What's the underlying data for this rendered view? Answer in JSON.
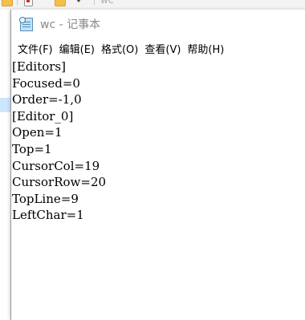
{
  "background_window": {
    "title": "wc"
  },
  "window": {
    "title": "wc - 记事本",
    "icon": "notepad-icon"
  },
  "menubar": {
    "items": [
      {
        "label": "文件(F)"
      },
      {
        "label": "编辑(E)"
      },
      {
        "label": "格式(O)"
      },
      {
        "label": "查看(V)"
      },
      {
        "label": "帮助(H)"
      }
    ]
  },
  "editor": {
    "lines": [
      "[Editors]",
      "Focused=0",
      "Order=-1,0",
      "[Editor_0]",
      "Open=1",
      "Top=1",
      "CursorCol=19",
      "CursorRow=20",
      "TopLine=9",
      "LeftChar=1"
    ]
  },
  "colors": {
    "window_bg": "#ffffff",
    "title_text": "#8a8a8a",
    "text": "#000000",
    "folder": "#f5c04a"
  }
}
